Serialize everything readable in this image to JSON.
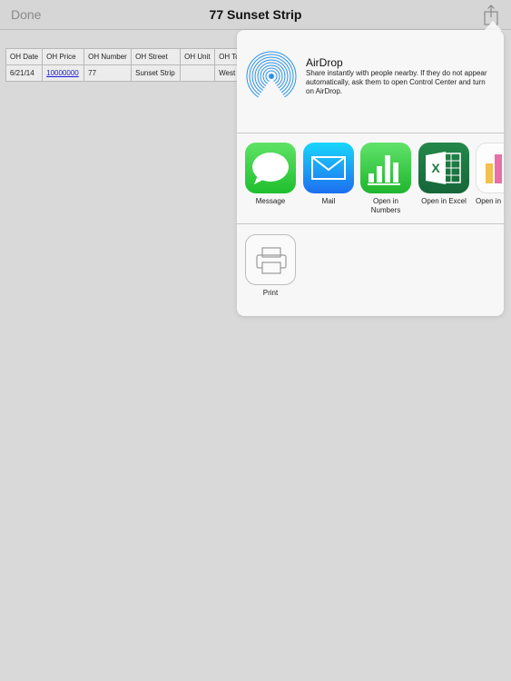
{
  "nav": {
    "done": "Done",
    "title": "77 Sunset Strip"
  },
  "table": {
    "headers": [
      "OH Date",
      "OH Price",
      "OH Number",
      "OH Street",
      "OH Unit",
      "OH To"
    ],
    "row": [
      "6/21/14",
      "10000000",
      "77",
      "Sunset Strip",
      "",
      "West H"
    ]
  },
  "share": {
    "airdrop_title": "AirDrop",
    "airdrop_desc": "Share instantly with people nearby. If they do not appear automatically, ask them to open Control Center and turn on AirDrop.",
    "apps": [
      {
        "label": "Message"
      },
      {
        "label": "Mail"
      },
      {
        "label": "Open in Numbers"
      },
      {
        "label": "Open in Excel"
      },
      {
        "label": "Open in"
      }
    ],
    "actions": [
      {
        "label": "Print"
      }
    ]
  },
  "colors": {
    "message_green": "#38c944",
    "mail_blue": "#1d8cf3",
    "numbers_green": "#2fc53c",
    "excel_green": "#1e7a41"
  }
}
